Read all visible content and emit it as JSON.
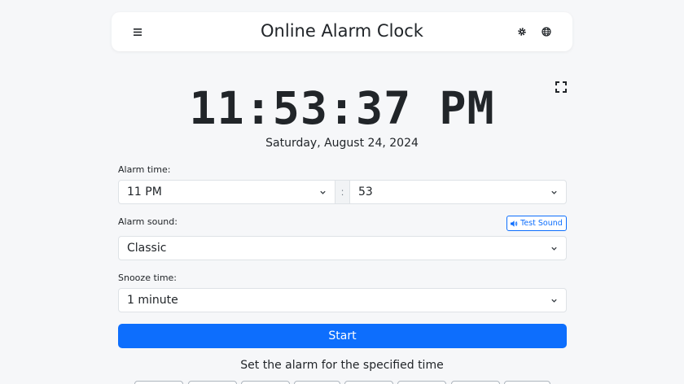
{
  "header": {
    "title": "Online Alarm Clock",
    "menu_icon": "hamburger-menu-icon",
    "settings_icon": "gear-icon",
    "language_icon": "globe-icon"
  },
  "clock": {
    "time": "11:53:37 PM",
    "date": "Saturday, August 24, 2024",
    "fullscreen_icon": "fullscreen-icon"
  },
  "alarm_time": {
    "label": "Alarm time:",
    "hour": "11 PM",
    "separator": ":",
    "minute": "53"
  },
  "alarm_sound": {
    "label": "Alarm sound:",
    "value": "Classic",
    "test_button": "Test Sound"
  },
  "snooze_time": {
    "label": "Snooze time:",
    "value": "1 minute"
  },
  "start_button": "Start",
  "preset_heading": "Set the alarm for the specified time",
  "colors": {
    "primary": "#0d6efd",
    "background": "#f6f7f9",
    "text": "#212529"
  }
}
